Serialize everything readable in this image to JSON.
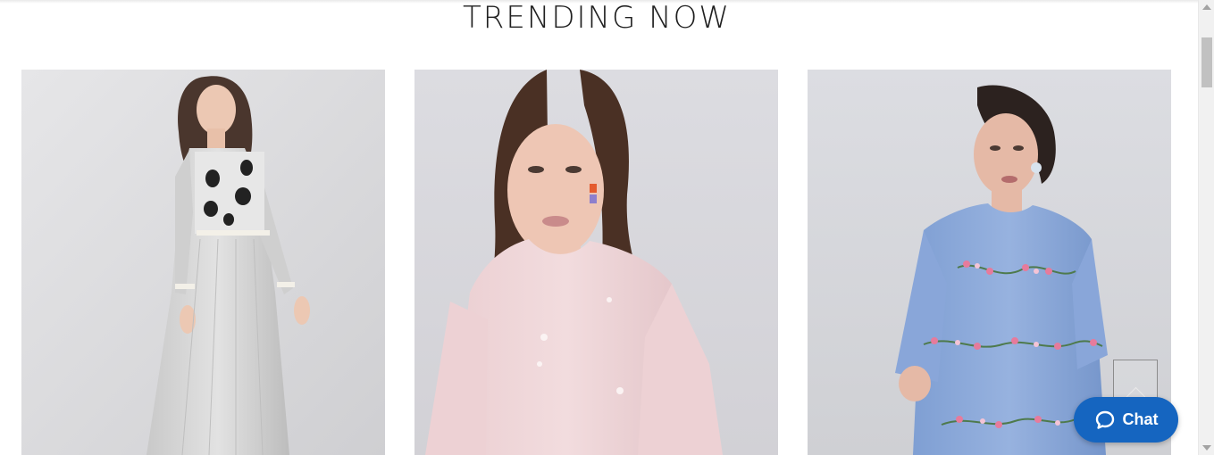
{
  "section": {
    "title": "TRENDING NOW"
  },
  "products": [
    {
      "name": "product-card-grey-embroidered-dress"
    },
    {
      "name": "product-card-pink-bell-sleeve-top"
    },
    {
      "name": "product-card-blue-floral-embroidered-top"
    }
  ],
  "chat": {
    "label": "Chat",
    "icon": "chat-bubble-icon",
    "color": "#1565c0"
  },
  "back_to_top": {
    "icon": "arrow-up-icon"
  }
}
